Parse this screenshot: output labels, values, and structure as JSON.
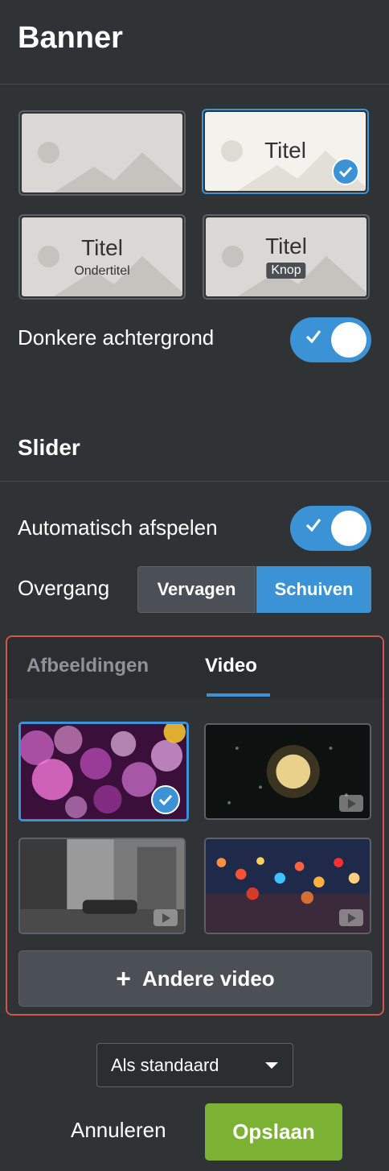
{
  "banner": {
    "title": "Banner",
    "layouts": [
      {
        "id": "plain",
        "title": "",
        "subtitle": "",
        "button": "",
        "selected": false
      },
      {
        "id": "title",
        "title": "Titel",
        "subtitle": "",
        "button": "",
        "selected": true
      },
      {
        "id": "title-subtitle",
        "title": "Titel",
        "subtitle": "Ondertitel",
        "button": "",
        "selected": false
      },
      {
        "id": "title-button",
        "title": "Titel",
        "subtitle": "",
        "button": "Knop",
        "selected": false
      }
    ],
    "dark_background_label": "Donkere achtergrond",
    "dark_background_on": true
  },
  "slider": {
    "title": "Slider",
    "autoplay_label": "Automatisch afspelen",
    "autoplay_on": true,
    "transition_label": "Overgang",
    "transition_options": [
      "Vervagen",
      "Schuiven"
    ],
    "transition_selected": "Schuiven"
  },
  "media": {
    "tabs": [
      "Afbeeldingen",
      "Video"
    ],
    "active_tab": "Video",
    "add_video_label": "Andere video",
    "videos": [
      {
        "name": "bokeh-purple",
        "selected": true
      },
      {
        "name": "rain-window-light",
        "selected": false
      },
      {
        "name": "city-street-bw",
        "selected": false
      },
      {
        "name": "city-lights-bokeh",
        "selected": false
      }
    ]
  },
  "footer": {
    "default_select_value": "Als standaard",
    "cancel_label": "Annuleren",
    "save_label": "Opslaan"
  },
  "colors": {
    "background": "#2f3336",
    "accent": "#3b93d6",
    "save": "#7cb234",
    "highlight_border": "#d4554a"
  }
}
